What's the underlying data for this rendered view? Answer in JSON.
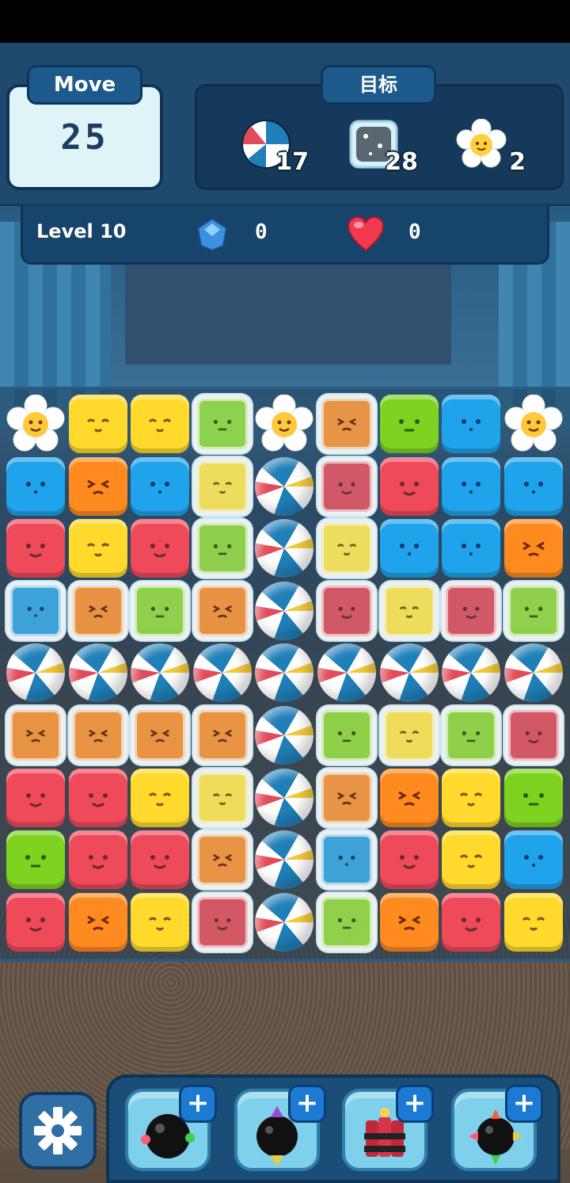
{
  "hud": {
    "move_label": "Move",
    "move_value": "25",
    "goal_label": "目标",
    "goals": [
      {
        "icon": "beach-ball-icon",
        "count": "17"
      },
      {
        "icon": "ice-block-icon",
        "count": "28"
      },
      {
        "icon": "flower-icon",
        "count": "2"
      }
    ],
    "level": "Level 10",
    "gems": "0",
    "lives": "0"
  },
  "board": {
    "rows": [
      [
        "flower",
        "yellow",
        "yellow",
        "ice-green",
        "flower",
        "ice-orange",
        "green",
        "blue",
        "flower"
      ],
      [
        "blue",
        "orange",
        "blue",
        "ice-yellow",
        "ball",
        "ice-red",
        "red",
        "blue",
        "blue"
      ],
      [
        "red",
        "yellow",
        "red",
        "ice-green",
        "ball",
        "ice-yellow",
        "blue",
        "blue",
        "orange"
      ],
      [
        "ice-blue",
        "ice-orange",
        "ice-green",
        "ice-orange",
        "ball",
        "ice-red",
        "ice-yellow",
        "ice-red",
        "ice-green"
      ],
      [
        "ball",
        "ball",
        "ball",
        "ball",
        "ball",
        "ball",
        "ball",
        "ball",
        "ball"
      ],
      [
        "ice-orange",
        "ice-orange",
        "ice-orange",
        "ice-orange",
        "ball",
        "ice-green",
        "ice-yellow",
        "ice-green",
        "ice-red"
      ],
      [
        "red",
        "red",
        "yellow",
        "ice-yellow",
        "ball",
        "ice-orange",
        "orange",
        "yellow",
        "green"
      ],
      [
        "green",
        "red",
        "red",
        "ice-orange",
        "ball",
        "ice-blue",
        "red",
        "yellow",
        "blue"
      ],
      [
        "red",
        "orange",
        "yellow",
        "ice-red",
        "ball",
        "ice-green",
        "orange",
        "red",
        "yellow"
      ]
    ],
    "colors": {
      "red": "#ef4a5a",
      "yellow": "#ffd92b",
      "green": "#7ed321",
      "blue": "#1fa3ea",
      "orange": "#ff8a1f"
    }
  },
  "boosters": [
    {
      "icon": "bomb-icon"
    },
    {
      "icon": "rocket-bomb-icon"
    },
    {
      "icon": "dynamite-icon"
    },
    {
      "icon": "spike-bomb-icon"
    }
  ]
}
